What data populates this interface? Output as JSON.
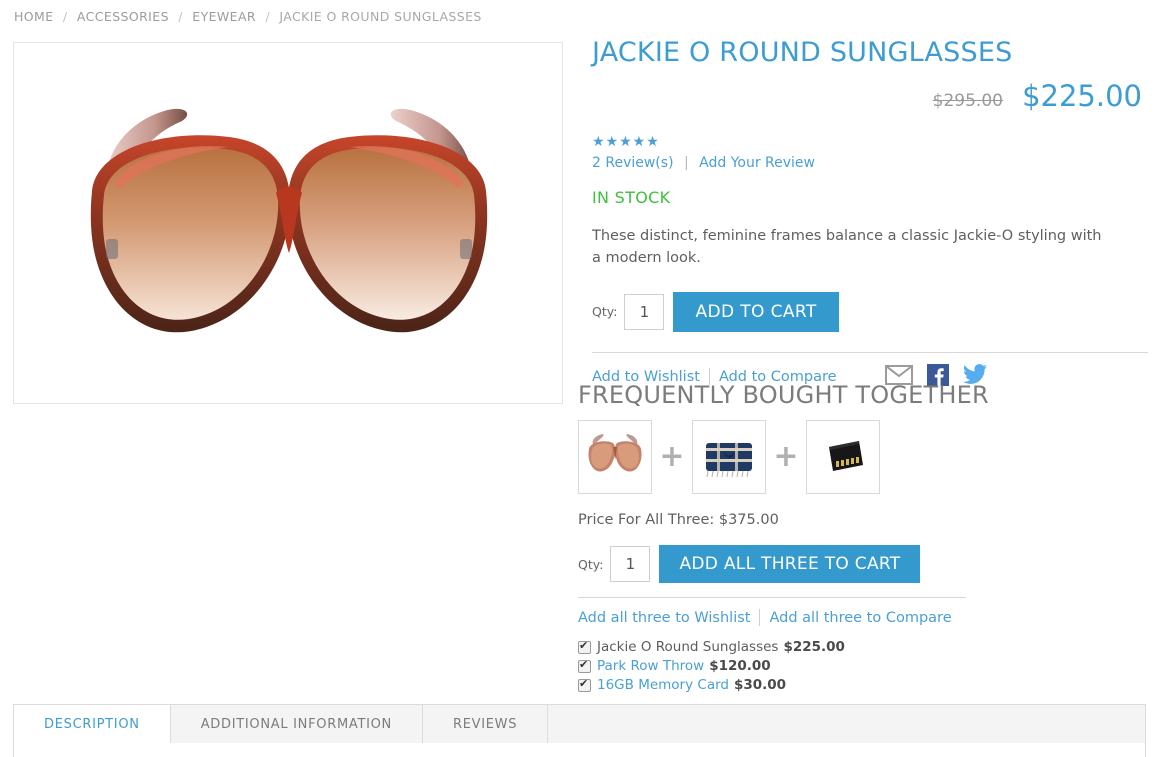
{
  "breadcrumb": {
    "items": [
      "HOME",
      "ACCESSORIES",
      "EYEWEAR",
      "JACKIE O ROUND SUNGLASSES"
    ],
    "separator": "/"
  },
  "product": {
    "title": "JACKIE O ROUND SUNGLASSES",
    "old_price": "$295.00",
    "price": "$225.00",
    "stars": "★★★★★",
    "rating_value": 5,
    "reviews_link": "2 Review(s)",
    "add_review_link": "Add Your Review",
    "review_separator": "|",
    "stock_status": "IN STOCK",
    "description": "These distinct, feminine frames balance a classic Jackie-O styling with a modern look.",
    "qty_label": "Qty:",
    "qty_value": "1",
    "add_to_cart_label": "ADD TO CART",
    "wishlist_label": "Add to Wishlist",
    "compare_label": "Add to Compare",
    "share_icons": [
      "email-icon",
      "facebook-icon",
      "twitter-icon"
    ],
    "image_alt": "Jackie O round sunglasses with reddish-brown frames and gradient brown lenses"
  },
  "frequently_bought_together": {
    "heading": "FREQUENTLY BOUGHT TOGETHER",
    "plus_symbol": "+",
    "thumbnails": [
      {
        "name": "sunglasses-thumbnail"
      },
      {
        "name": "throw-thumbnail"
      },
      {
        "name": "memory-card-thumbnail"
      }
    ],
    "price_for_all_label": "Price For All Three: $375.00",
    "qty_label": "Qty:",
    "qty_value": "1",
    "add_all_label": "ADD ALL THREE TO CART",
    "wishlist_label": "Add all three to Wishlist",
    "compare_label": "Add all three to Compare",
    "items": [
      {
        "name": "Jackie O Round Sunglasses",
        "price": "$225.00",
        "checked": true,
        "is_link": false
      },
      {
        "name": "Park Row Throw",
        "price": "$120.00",
        "checked": true,
        "is_link": true
      },
      {
        "name": "16GB Memory Card",
        "price": "$30.00",
        "checked": true,
        "is_link": true
      }
    ]
  },
  "tabs": [
    {
      "label": "DESCRIPTION",
      "active": true
    },
    {
      "label": "ADDITIONAL INFORMATION",
      "active": false
    },
    {
      "label": "REVIEWS",
      "active": false
    }
  ],
  "colors": {
    "accent_blue": "#3499cd",
    "title_blue": "#3d9cd2",
    "link_blue": "#4a9fd4",
    "stock_green": "#3fbf3f",
    "facebook_blue": "#3b5998",
    "twitter_blue": "#55acee",
    "old_price_grey": "#9a9a9a",
    "border_grey": "#dcdcdc"
  }
}
